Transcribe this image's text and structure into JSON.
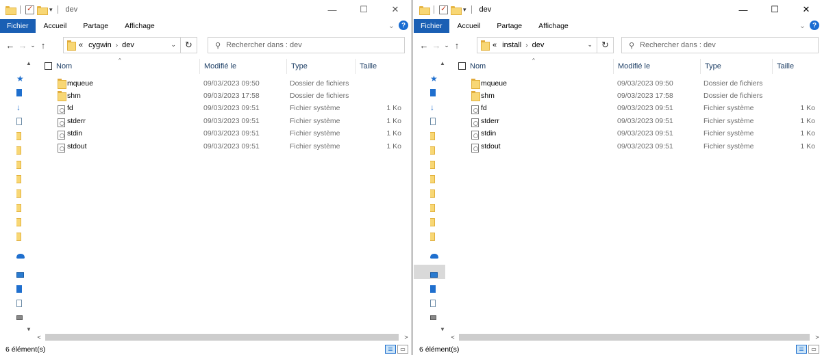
{
  "windows": [
    {
      "id": "left",
      "title": "dev",
      "ribbon": {
        "tabs": [
          "Fichier",
          "Accueil",
          "Partage",
          "Affichage"
        ]
      },
      "address": {
        "overflow": "«",
        "crumbs": [
          "cygwin",
          "dev"
        ]
      },
      "search": {
        "placeholder": "Rechercher dans : dev"
      },
      "columns": {
        "name": "Nom",
        "modified": "Modifié le",
        "type": "Type",
        "size": "Taille"
      },
      "rows": [
        {
          "name": "mqueue",
          "modified": "09/03/2023 09:50",
          "type": "Dossier de fichiers",
          "size": "",
          "icon": "folder-icon"
        },
        {
          "name": "shm",
          "modified": "09/03/2023 17:58",
          "type": "Dossier de fichiers",
          "size": "",
          "icon": "folder-icon"
        },
        {
          "name": "fd",
          "modified": "09/03/2023 09:51",
          "type": "Fichier système",
          "size": "1 Ko",
          "icon": "system-file-icon"
        },
        {
          "name": "stderr",
          "modified": "09/03/2023 09:51",
          "type": "Fichier système",
          "size": "1 Ko",
          "icon": "system-file-icon"
        },
        {
          "name": "stdin",
          "modified": "09/03/2023 09:51",
          "type": "Fichier système",
          "size": "1 Ko",
          "icon": "system-file-icon"
        },
        {
          "name": "stdout",
          "modified": "09/03/2023 09:51",
          "type": "Fichier système",
          "size": "1 Ko",
          "icon": "system-file-icon"
        }
      ],
      "status": "6 élément(s)"
    },
    {
      "id": "right",
      "title": "dev",
      "ribbon": {
        "tabs": [
          "Fichier",
          "Accueil",
          "Partage",
          "Affichage"
        ]
      },
      "address": {
        "overflow": "«",
        "crumbs": [
          "install",
          "dev"
        ]
      },
      "search": {
        "placeholder": "Rechercher dans : dev"
      },
      "columns": {
        "name": "Nom",
        "modified": "Modifié le",
        "type": "Type",
        "size": "Taille"
      },
      "rows": [
        {
          "name": "mqueue",
          "modified": "09/03/2023 09:50",
          "type": "Dossier de fichiers",
          "size": "",
          "icon": "folder-icon"
        },
        {
          "name": "shm",
          "modified": "09/03/2023 17:58",
          "type": "Dossier de fichiers",
          "size": "",
          "icon": "folder-icon"
        },
        {
          "name": "fd",
          "modified": "09/03/2023 09:51",
          "type": "Fichier système",
          "size": "1 Ko",
          "icon": "system-file-icon"
        },
        {
          "name": "stderr",
          "modified": "09/03/2023 09:51",
          "type": "Fichier système",
          "size": "1 Ko",
          "icon": "system-file-icon"
        },
        {
          "name": "stdin",
          "modified": "09/03/2023 09:51",
          "type": "Fichier système",
          "size": "1 Ko",
          "icon": "system-file-icon"
        },
        {
          "name": "stdout",
          "modified": "09/03/2023 09:51",
          "type": "Fichier système",
          "size": "1 Ko",
          "icon": "system-file-icon"
        }
      ],
      "status": "6 élément(s)"
    }
  ],
  "colors": {
    "accent": "#1a5fb4",
    "folder": "#f8d775",
    "header_text": "#1e3f66"
  }
}
